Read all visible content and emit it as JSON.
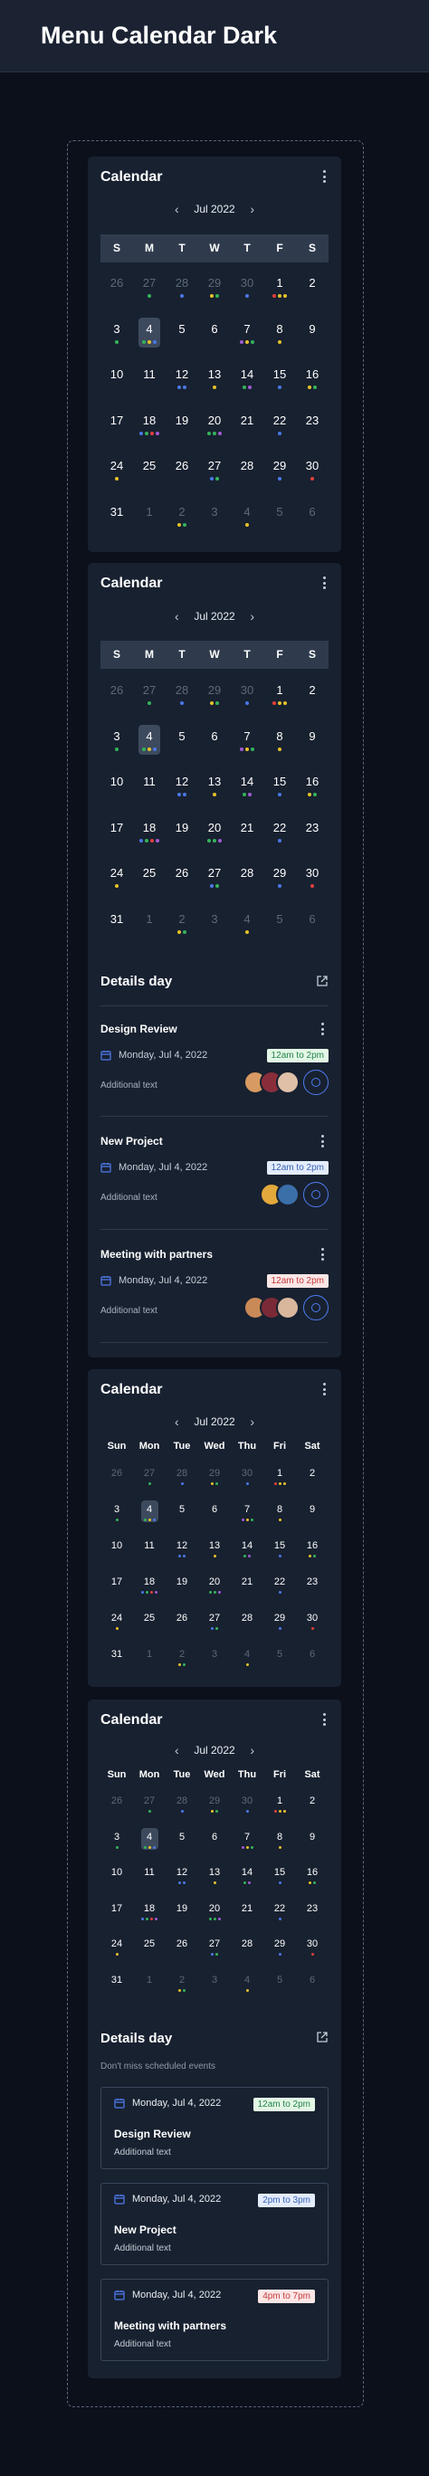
{
  "page": {
    "title": "Menu Calendar Dark"
  },
  "colors": {
    "green": "#35b35a",
    "blue": "#4a78e8",
    "yellow": "#e6c229",
    "red": "#e2403b",
    "purple": "#a15ad4",
    "orange": "#ee8a2c",
    "pink": "#e04a8e",
    "selected": "#3d4a5e"
  },
  "calendar": {
    "title": "Calendar",
    "month": "Jul 2022",
    "weekdays_short": [
      "S",
      "M",
      "T",
      "W",
      "T",
      "F",
      "S"
    ],
    "weekdays_long": [
      "Sun",
      "Mon",
      "Tue",
      "Wed",
      "Thu",
      "Fri",
      "Sat"
    ],
    "days": [
      {
        "n": "26",
        "m": true,
        "dots": []
      },
      {
        "n": "27",
        "m": true,
        "dots": [
          "green"
        ]
      },
      {
        "n": "28",
        "m": true,
        "dots": [
          "blue"
        ]
      },
      {
        "n": "29",
        "m": true,
        "dots": [
          "yellow",
          "green"
        ]
      },
      {
        "n": "30",
        "m": true,
        "dots": [
          "blue"
        ]
      },
      {
        "n": "1",
        "dots": [
          "red",
          "yellow",
          "yellow"
        ]
      },
      {
        "n": "2",
        "dots": []
      },
      {
        "n": "3",
        "dots": [
          "green"
        ]
      },
      {
        "n": "4",
        "sel": true,
        "dots": [
          "green",
          "yellow",
          "blue"
        ]
      },
      {
        "n": "5",
        "dots": []
      },
      {
        "n": "6",
        "dots": []
      },
      {
        "n": "7",
        "dots": [
          "purple",
          "yellow",
          "green"
        ]
      },
      {
        "n": "8",
        "dots": [
          "yellow"
        ]
      },
      {
        "n": "9",
        "dots": []
      },
      {
        "n": "10",
        "dots": []
      },
      {
        "n": "11",
        "dots": []
      },
      {
        "n": "12",
        "dots": [
          "blue",
          "blue"
        ]
      },
      {
        "n": "13",
        "dots": [
          "yellow"
        ]
      },
      {
        "n": "14",
        "dots": [
          "green",
          "purple"
        ]
      },
      {
        "n": "15",
        "dots": [
          "blue"
        ]
      },
      {
        "n": "16",
        "dots": [
          "yellow",
          "green"
        ]
      },
      {
        "n": "17",
        "dots": []
      },
      {
        "n": "18",
        "dots": [
          "blue",
          "green",
          "red",
          "purple"
        ]
      },
      {
        "n": "19",
        "dots": []
      },
      {
        "n": "20",
        "dots": [
          "green",
          "green",
          "purple"
        ]
      },
      {
        "n": "21",
        "dots": []
      },
      {
        "n": "22",
        "dots": [
          "blue"
        ]
      },
      {
        "n": "23",
        "dots": []
      },
      {
        "n": "24",
        "dots": [
          "yellow"
        ]
      },
      {
        "n": "25",
        "dots": []
      },
      {
        "n": "26",
        "dots": []
      },
      {
        "n": "27",
        "dots": [
          "blue",
          "green"
        ]
      },
      {
        "n": "28",
        "dots": []
      },
      {
        "n": "29",
        "dots": [
          "blue"
        ]
      },
      {
        "n": "30",
        "dots": [
          "red"
        ]
      },
      {
        "n": "31",
        "dots": []
      },
      {
        "n": "1",
        "m": true,
        "dots": []
      },
      {
        "n": "2",
        "m": true,
        "dots": [
          "yellow",
          "green"
        ]
      },
      {
        "n": "3",
        "m": true,
        "dots": []
      },
      {
        "n": "4",
        "m": true,
        "dots": [
          "yellow"
        ]
      },
      {
        "n": "5",
        "m": true,
        "dots": []
      },
      {
        "n": "6",
        "m": true,
        "dots": []
      }
    ]
  },
  "details1": {
    "title": "Details day",
    "events": [
      {
        "title": "Design Review",
        "date": "Monday, Jul 4, 2022",
        "time": "12am to 2pm",
        "badge": "green",
        "additional": "Additional text",
        "avatars": [
          "#d79a62",
          "#8a2d3b",
          "#e0c1a8"
        ]
      },
      {
        "title": "New Project",
        "date": "Monday, Jul 4, 2022",
        "time": "12am to 2pm",
        "badge": "blue",
        "additional": "Additional text",
        "avatars": [
          "#e3a83c",
          "#3b6fa8"
        ]
      },
      {
        "title": "Meeting with partners",
        "date": "Monday, Jul 4, 2022",
        "time": "12am to 2pm",
        "badge": "red",
        "additional": "Additional text",
        "avatars": [
          "#c98a58",
          "#7a2a36",
          "#d9b79d"
        ]
      }
    ]
  },
  "details2": {
    "title": "Details day",
    "subtitle": "Don't miss scheduled events",
    "events": [
      {
        "title": "Design Review",
        "date": "Monday, Jul 4, 2022",
        "time": "12am to 2pm",
        "badge": "green",
        "additional": "Additional text"
      },
      {
        "title": "New Project",
        "date": "Monday, Jul 4, 2022",
        "time": "2pm to 3pm",
        "badge": "blue",
        "additional": "Additional text"
      },
      {
        "title": "Meeting with partners",
        "date": "Monday, Jul 4, 2022",
        "time": "4pm to 7pm",
        "badge": "red",
        "additional": "Additional text"
      }
    ]
  }
}
